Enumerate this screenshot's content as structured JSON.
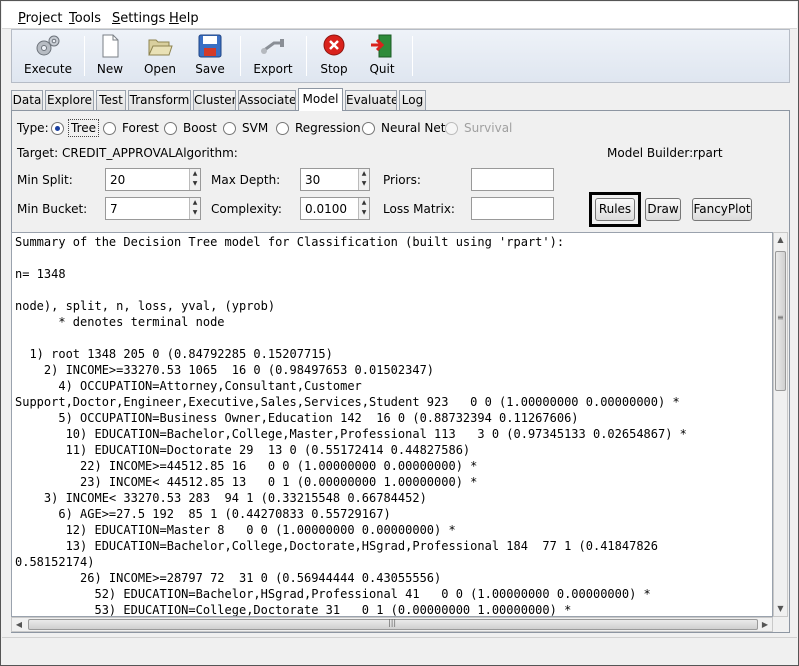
{
  "menu": {
    "project": "Project",
    "tools": "Tools",
    "settings": "Settings",
    "help": "Help"
  },
  "toolbar": {
    "execute": "Execute",
    "new": "New",
    "open": "Open",
    "save": "Save",
    "export": "Export",
    "stop": "Stop",
    "quit": "Quit"
  },
  "tabs": [
    "Data",
    "Explore",
    "Test",
    "Transform",
    "Cluster",
    "Associate",
    "Model",
    "Evaluate",
    "Log"
  ],
  "model": {
    "type_label": "Type:",
    "types": [
      "Tree",
      "Forest",
      "Boost",
      "SVM",
      "Regression",
      "Neural Net",
      "Survival"
    ],
    "selected_type": "Tree",
    "target": "Target: CREDIT_APPROVAL",
    "algorithm": "Algorithm:",
    "builder_label": "Model Builder:",
    "builder_value": "rpart",
    "min_split_label": "Min Split:",
    "min_split": "20",
    "max_depth_label": "Max Depth:",
    "max_depth": "30",
    "priors_label": "Priors:",
    "min_bucket_label": "Min Bucket:",
    "min_bucket": "7",
    "complexity_label": "Complexity:",
    "complexity": "0.0100",
    "loss_matrix_label": "Loss Matrix:",
    "rules_button": "Rules",
    "draw_button": "Draw",
    "fancyplot_button": "FancyPlot"
  },
  "output": {
    "lines": [
      "Summary of the Decision Tree model for Classification (built using 'rpart'):",
      "",
      "n= 1348",
      "",
      "node), split, n, loss, yval, (yprob)",
      "      * denotes terminal node",
      "",
      "  1) root 1348 205 0 (0.84792285 0.15207715)",
      "    2) INCOME>=33270.53 1065  16 0 (0.98497653 0.01502347)",
      "      4) OCCUPATION=Attorney,Consultant,Customer",
      "Support,Doctor,Engineer,Executive,Sales,Services,Student 923   0 0 (1.00000000 0.00000000) *",
      "      5) OCCUPATION=Business Owner,Education 142  16 0 (0.88732394 0.11267606)",
      "       10) EDUCATION=Bachelor,College,Master,Professional 113   3 0 (0.97345133 0.02654867) *",
      "       11) EDUCATION=Doctorate 29  13 0 (0.55172414 0.44827586)",
      "         22) INCOME>=44512.85 16   0 0 (1.00000000 0.00000000) *",
      "         23) INCOME< 44512.85 13   0 1 (0.00000000 1.00000000) *",
      "    3) INCOME< 33270.53 283  94 1 (0.33215548 0.66784452)",
      "      6) AGE>=27.5 192  85 1 (0.44270833 0.55729167)",
      "       12) EDUCATION=Master 8   0 0 (1.00000000 0.00000000) *",
      "       13) EDUCATION=Bachelor,College,Doctorate,HSgrad,Professional 184  77 1 (0.41847826",
      "0.58152174)",
      "         26) INCOME>=28797 72  31 0 (0.56944444 0.43055556)",
      "           52) EDUCATION=Bachelor,HSgrad,Professional 41   0 0 (1.00000000 0.00000000) *",
      "           53) EDUCATION=College,Doctorate 31   0 1 (0.00000000 1.00000000) *"
    ]
  },
  "colors": {
    "stop_red": "#d9221c",
    "radio_dot": "#1a3fa0",
    "highlight_border": "#000000"
  }
}
